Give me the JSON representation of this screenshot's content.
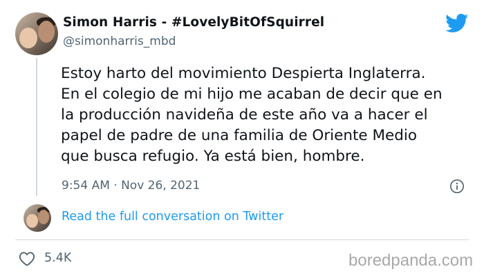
{
  "user": {
    "display_name": "Simon Harris - #LovelyBitOfSquirrel",
    "handle": "@simonharris_mbd"
  },
  "tweet": {
    "text": "Estoy harto del movimiento Despierta Inglaterra.\nEn el colegio de mi hijo me acaban de decir que en\nla producción navideña de este año va a hacer el\npapel de padre de una familia de Oriente Medio\nque busca refugio. Ya está bien, hombre.",
    "timestamp": "9:54 AM · Nov 26, 2021"
  },
  "conversation_link": "Read the full conversation on Twitter",
  "likes": "5.4K",
  "watermark": "boredpanda.com",
  "icons": {
    "brand": "twitter-bird-icon",
    "info": "info-icon",
    "like": "heart-icon"
  },
  "colors": {
    "twitter_blue": "#1d9bf0",
    "secondary_text": "#536471",
    "primary_text": "#0f1419",
    "divider": "#cfd9de"
  }
}
